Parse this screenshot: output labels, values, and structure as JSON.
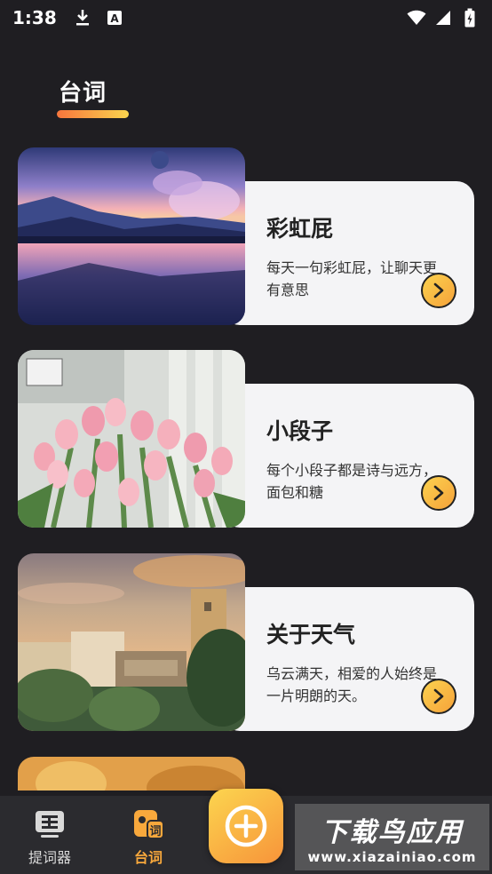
{
  "status_bar": {
    "time": "1:38",
    "icons_left": [
      "download-icon",
      "a-badge-icon"
    ],
    "icons_right": [
      "wifi-icon",
      "signal-icon",
      "battery-icon"
    ]
  },
  "header": {
    "title": "台词"
  },
  "colors": {
    "background": "#1f1e22",
    "card_panel": "#f4f4f6",
    "accent_gradient_start": "#f7763d",
    "accent_gradient_end": "#fbd54e",
    "active_tab": "#f8a83c"
  },
  "cards": [
    {
      "title": "彩虹屁",
      "desc": "每天一句彩虹屁，让聊天更有意思",
      "image": "sunset-lake-landscape"
    },
    {
      "title": "小段子",
      "desc": "每个小段子都是诗与远方，面包和糖",
      "image": "pink-tulips"
    },
    {
      "title": "关于天气",
      "desc": "乌云满天，相爱的人始终是一片明朗的天。",
      "image": "city-buildings-sunset"
    }
  ],
  "tabs": [
    {
      "label": "提词器",
      "icon": "teleprompter-icon",
      "active": false
    },
    {
      "label": "台词",
      "icon": "lines-icon",
      "active": true
    }
  ],
  "fab": {
    "icon": "plus-circle-icon"
  },
  "watermark": {
    "main": "下载鸟应用",
    "sub": "www.xiazainiao.com"
  }
}
